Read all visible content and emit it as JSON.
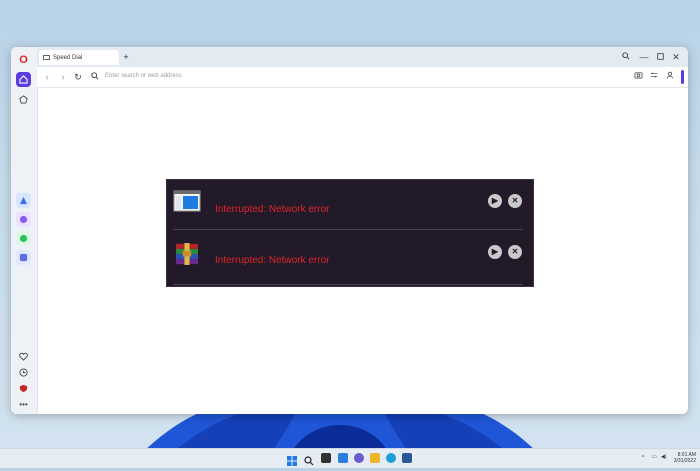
{
  "browser": {
    "tab": {
      "label": "Speed Dial"
    },
    "address": {
      "placeholder": "Enter search or web address"
    },
    "sidebar": {
      "logo": "O"
    }
  },
  "downloads": [
    {
      "status": "Interrupted: Network error",
      "icon": "window-app-icon"
    },
    {
      "status": "Interrupted: Network error",
      "icon": "winrar-archive-icon"
    }
  ],
  "taskbar": {
    "time": "8:01 AM",
    "date": "3/31/2022"
  },
  "colors": {
    "error": "#e0242b",
    "panel": "#221a29",
    "accent": "#5a3ce0"
  }
}
